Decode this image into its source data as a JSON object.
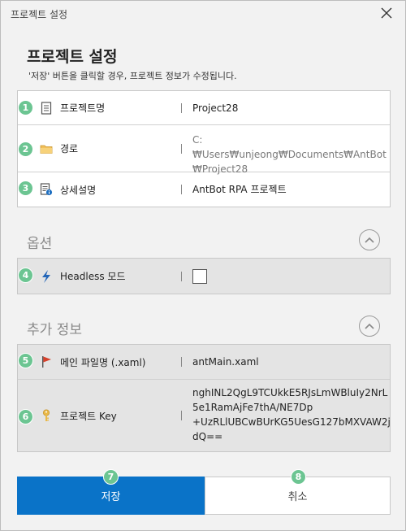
{
  "window": {
    "title": "프로젝트 설정",
    "close_icon": "close-icon"
  },
  "header": {
    "heading": "프로젝트 설정",
    "subtext": "'저장' 버튼을 클릭할 경우, 프로젝트 정보가 수정됩니다."
  },
  "project": {
    "name": {
      "badge": "1",
      "icon": "document-icon",
      "label": "프로젝트명",
      "value": "Project28"
    },
    "path": {
      "badge": "2",
      "icon": "folder-icon",
      "label": "경로",
      "value_line1": "C:₩Users₩unjeong₩Documents₩AntBot",
      "value_line2": "₩Project28"
    },
    "description": {
      "badge": "3",
      "icon": "document-info-icon",
      "label": "상세설명",
      "value": "AntBot RPA 프로젝트"
    }
  },
  "options": {
    "title": "옵션",
    "headless": {
      "badge": "4",
      "icon": "lightning-icon",
      "label": "Headless 모드",
      "checked": false
    }
  },
  "additional": {
    "title": "추가 정보",
    "main_file": {
      "badge": "5",
      "icon": "flag-icon",
      "label": "메인 파일명 (.xaml)",
      "value": "antMain.xaml"
    },
    "key": {
      "badge": "6",
      "icon": "key-icon",
      "label": "프로젝트 Key",
      "lines": [
        "nghINL2QgL9TCUkkE5RJsLmWBluIy2NrL",
        "5e1RamAjFe7thA/NE7Dp",
        "+UzRLlUBCwBUrKG5UesG127bMXVAW2j",
        "dQ=="
      ]
    }
  },
  "buttons": {
    "save": {
      "badge": "7",
      "label": "저장"
    },
    "cancel": {
      "badge": "8",
      "label": "취소"
    }
  },
  "colors": {
    "accent": "#0a73c8",
    "badge": "#6cc592"
  }
}
